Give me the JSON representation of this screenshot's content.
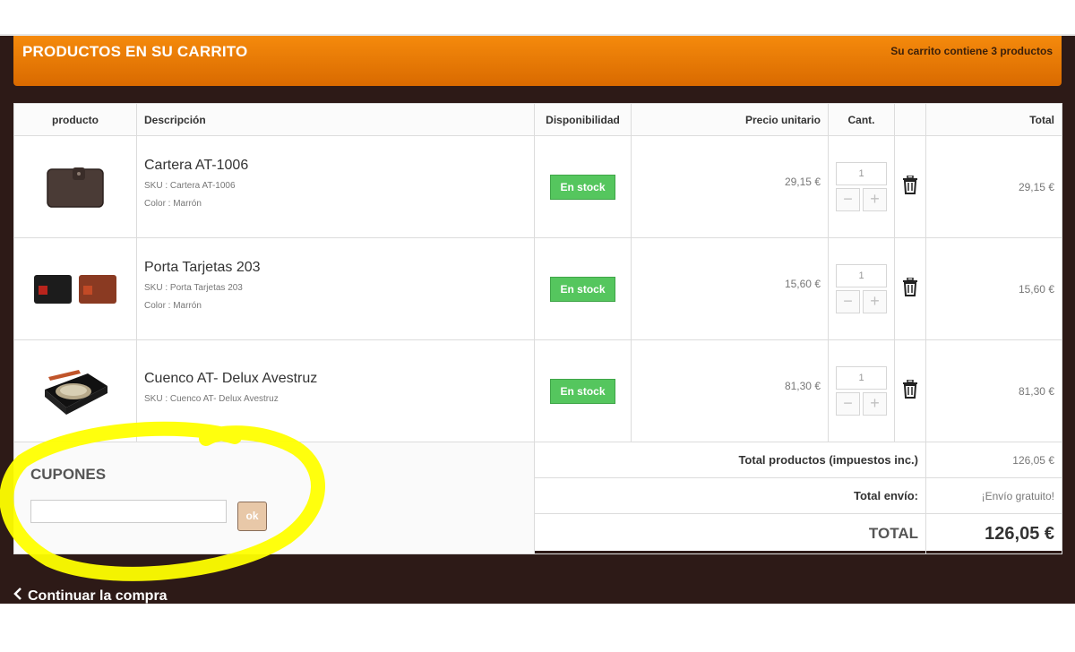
{
  "header": {
    "title": "PRODUCTOS EN SU CARRITO",
    "count": "Su carrito contiene 3 productos"
  },
  "table": {
    "columns": [
      "producto",
      "Descripción",
      "Disponibilidad",
      "Precio unitario",
      "Cant.",
      "",
      "Total"
    ],
    "items": [
      {
        "name": "Cartera AT-1006",
        "sku": "SKU : Cartera AT-1006",
        "color": "Color : Marrón",
        "availability": "En stock",
        "unit_price": "29,15 €",
        "qty": "1",
        "total": "29,15 €"
      },
      {
        "name": "Porta Tarjetas 203",
        "sku": "SKU : Porta Tarjetas 203",
        "color": "Color : Marrón",
        "availability": "En stock",
        "unit_price": "15,60 €",
        "qty": "1",
        "total": "15,60 €"
      },
      {
        "name": "Cuenco AT- Delux Avestruz",
        "sku": "SKU : Cuenco AT- Delux Avestruz",
        "color": "",
        "availability": "En stock",
        "unit_price": "81,30 €",
        "qty": "1",
        "total": "81,30 €"
      }
    ]
  },
  "summary": {
    "products_label": "Total productos (impuestos inc.)",
    "products_value": "126,05 €",
    "shipping_label": "Total envío:",
    "shipping_value": "¡Envío gratuito!",
    "total_label": "TOTAL",
    "total_value": "126,05 €"
  },
  "coupons": {
    "title": "CUPONES",
    "input_value": "",
    "button": "ok"
  },
  "footer": {
    "continue": "Continuar la compra"
  },
  "colors": {
    "accent": "#f07f08",
    "stock": "#55c65e",
    "page_bg": "#2d1a17",
    "highlight": "#ffff00"
  }
}
